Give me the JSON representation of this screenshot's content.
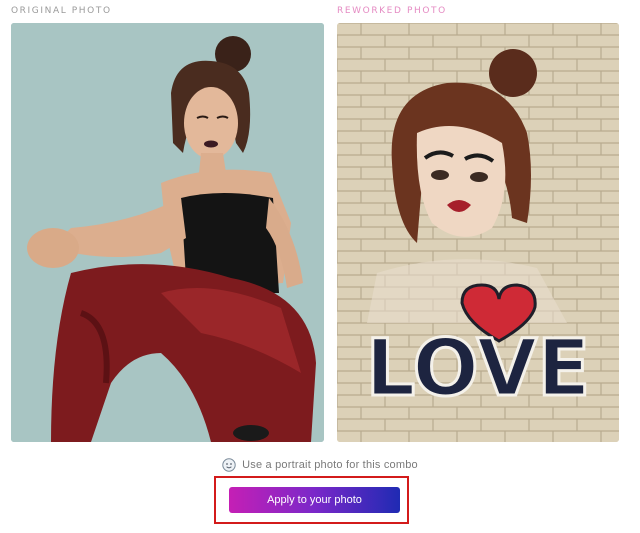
{
  "labels": {
    "original": "ORIGINAL PHOTO",
    "reworked": "REWORKED PHOTO"
  },
  "reworked_art": {
    "word": "LOVE"
  },
  "hint": {
    "text": "Use a portrait photo for this combo",
    "icon": "face-icon"
  },
  "apply_button": {
    "label": "Apply to your photo"
  },
  "colors": {
    "original_label": "#9a9a9a",
    "reworked_label": "#e58bc3",
    "button_gradient_start": "#c51fb5",
    "button_gradient_end": "#1f2ab3",
    "highlight_frame": "#d31b1b"
  }
}
